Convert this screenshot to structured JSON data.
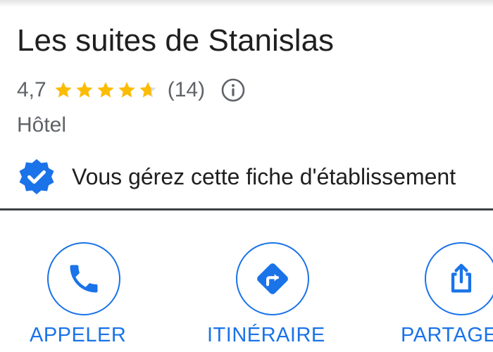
{
  "business": {
    "name": "Les suites de Stanislas",
    "rating": "4,7",
    "rating_value": 4.7,
    "rating_max": 5,
    "review_count": "(14)",
    "category": "Hôtel"
  },
  "ownership": {
    "message": "Vous gérez cette fiche d'établissement"
  },
  "actions": [
    {
      "label": "APPELER",
      "icon": "phone-icon"
    },
    {
      "label": "ITINÉRAIRE",
      "icon": "directions-icon"
    },
    {
      "label": "PARTAGER",
      "icon": "share-icon"
    }
  ],
  "colors": {
    "accent": "#1a73e8",
    "star": "#fbbc04",
    "star_empty": "#dadce0",
    "title_text": "#1f1f1f",
    "secondary_text": "#5f6368"
  }
}
